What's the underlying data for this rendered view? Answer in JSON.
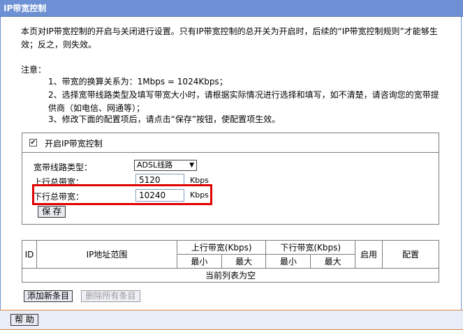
{
  "window": {
    "title": "IP带宽控制"
  },
  "description": "本页对IP带宽控制的开启与关闭进行设置。只有IP带宽控制的总开关为开启时，后续的“IP带宽控制规则”才能够生效；反之，则失效。",
  "notes": {
    "title": "注意：",
    "items": [
      "1、带宽的换算关系为：1Mbps = 1024Kbps；",
      "2、选择宽带线路类型及填写带宽大小时，请根据实际情况进行选择和填写，如不清楚，请咨询您的宽带提供商（如电信、网通等）；",
      "3、修改下面的配置项后，请点击“保存”按钮，使配置项生效。"
    ]
  },
  "settings": {
    "enable_label": "开启IP带宽控制",
    "enable_checked": true,
    "line_type_label": "宽带线路类型：",
    "line_type_value": "ADSL线路",
    "upload_label": "上行总带宽：",
    "upload_value": "5120",
    "upload_unit": "Kbps",
    "download_label": "下行总带宽：",
    "download_value": "10240",
    "download_unit": "Kbps",
    "save_label": "保 存"
  },
  "rules_table": {
    "col_id": "ID",
    "col_ip": "IP地址范围",
    "col_up": "上行带宽(Kbps)",
    "col_down": "下行带宽(Kbps)",
    "col_min": "最小",
    "col_max": "最大",
    "col_enable": "启用",
    "col_config": "配置",
    "empty_text": "当前列表为空"
  },
  "actions": {
    "add_label": "添加新条目",
    "delete_all_label": "删除所有条目",
    "help_label": "帮 助"
  }
}
